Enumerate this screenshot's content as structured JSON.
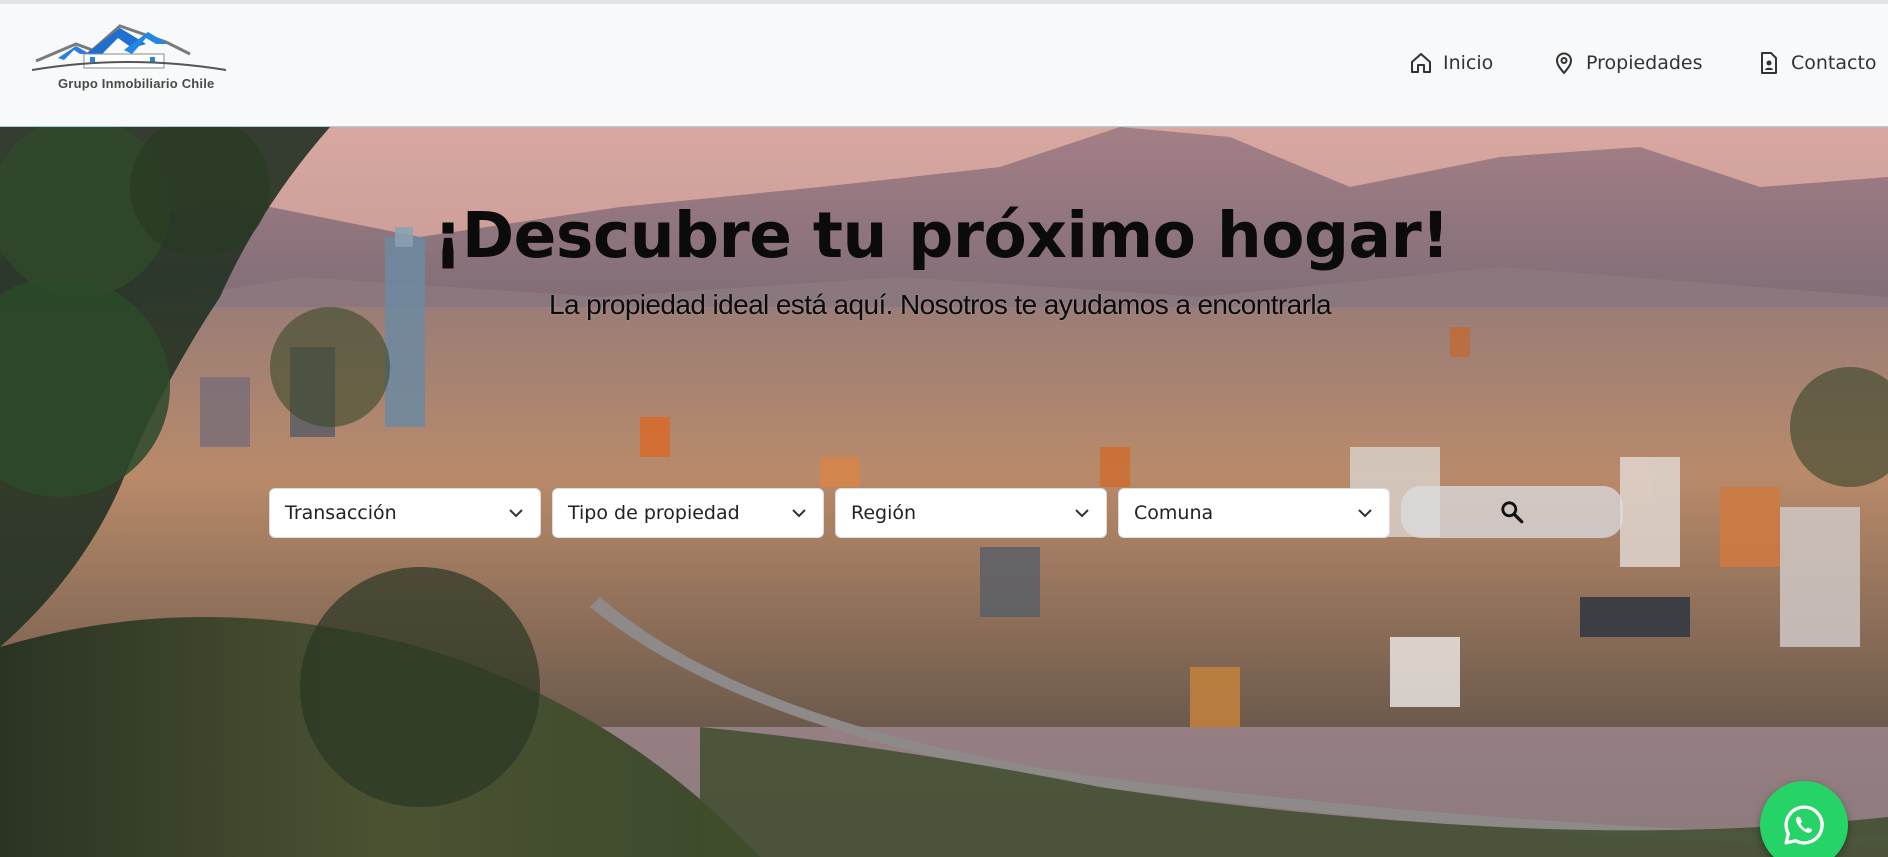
{
  "brand": {
    "logo_text": "Grupo Inmobiliario Chile"
  },
  "nav": {
    "items": [
      {
        "label": "Inicio",
        "icon": "home-icon"
      },
      {
        "label": "Propiedades",
        "icon": "map-pin-icon"
      },
      {
        "label": "Contacto",
        "icon": "document-contact-icon"
      }
    ]
  },
  "hero": {
    "title": "¡Descubre tu próximo hogar!",
    "subtitle": "La propiedad ideal está aquí. Nosotros te ayudamos a encontrarla"
  },
  "search": {
    "filters": [
      {
        "selected": "Transacción"
      },
      {
        "selected": "Tipo de propiedad"
      },
      {
        "selected": "Región"
      },
      {
        "selected": "Comuna"
      }
    ],
    "button_icon": "search-icon"
  },
  "floating": {
    "whatsapp_icon": "whatsapp-icon"
  },
  "colors": {
    "navbar_bg": "#f8f9fa",
    "whatsapp_green": "#25d366",
    "logo_blue": "#1f6fd0"
  }
}
